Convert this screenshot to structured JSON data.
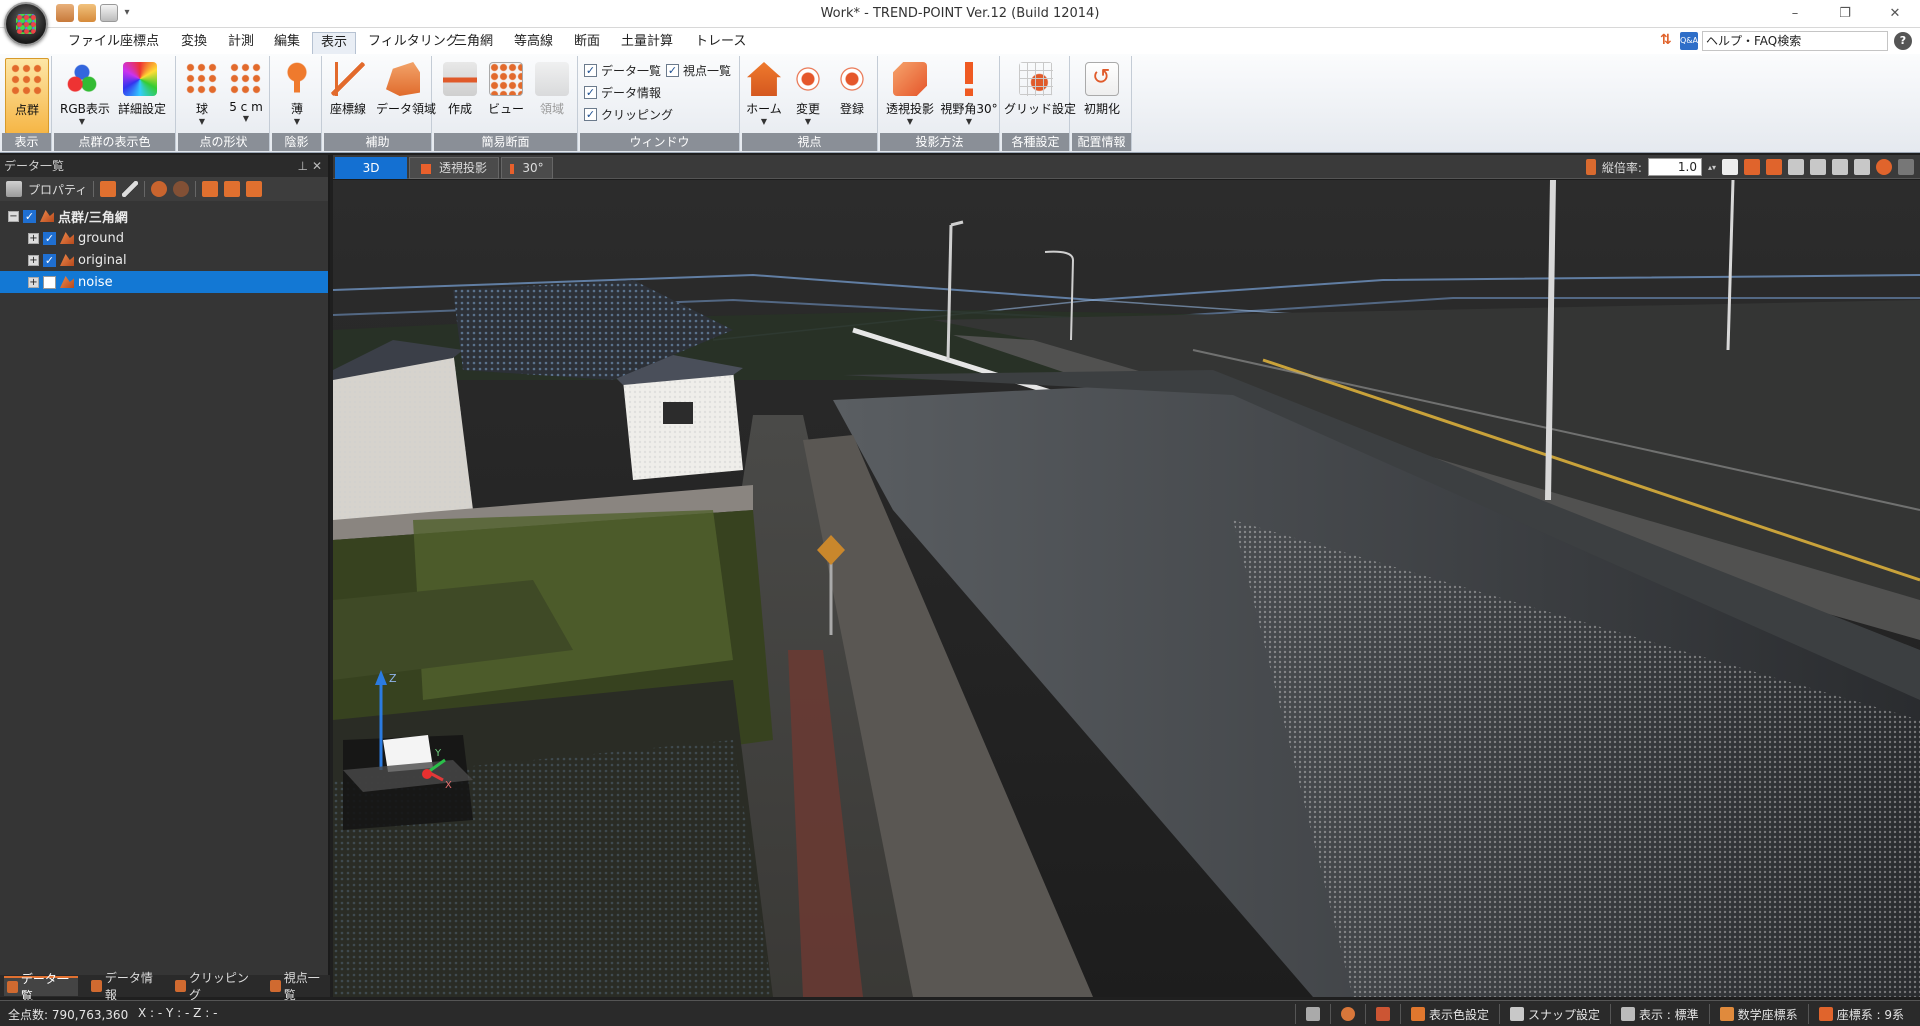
{
  "window": {
    "title": "Work* - TREND-POINT Ver.12 (Build 12014)",
    "minimize": "–",
    "maximize": "❐",
    "close": "✕"
  },
  "menu": {
    "tabs": [
      "ファイル",
      "座標点",
      "変換",
      "計測",
      "編集",
      "表示",
      "フィルタリング",
      "三角網",
      "等高線",
      "断面",
      "土量計算",
      "トレース"
    ],
    "active": "表示",
    "search_placeholder": "ヘルプ・FAQ検索",
    "qa_badge": "Q&A",
    "help": "?"
  },
  "ribbon": {
    "groups": {
      "display": "表示",
      "color": "点群の表示色",
      "shape": "点の形状",
      "shade": "陰影",
      "aux": "補助",
      "section": "簡易断面",
      "window": "ウィンドウ",
      "viewpoint": "視点",
      "projection": "投影方法",
      "settings": "各種設定",
      "layout": "配置情報"
    },
    "buttons": {
      "pointcloud": "点群",
      "rgb": "RGB表示",
      "detail": "詳細設定",
      "sphere": "球",
      "size": "5 c m",
      "thin": "薄",
      "axis": "座標線",
      "data_area": "データ領域",
      "make": "作成",
      "view": "ビュー",
      "area": "領域",
      "home": "ホーム",
      "change": "変更",
      "register": "登録",
      "perspective": "透視投影",
      "fov": "視野角30°",
      "grid": "グリッド設定",
      "init": "初期化"
    },
    "checks": {
      "data_list": "データ一覧",
      "viewpoint_list": "視点一覧",
      "data_info": "データ情報",
      "clipping": "クリッピング"
    }
  },
  "panel": {
    "title": "データ一覧",
    "toolbar_property": "プロパティ",
    "tree": {
      "root": "点群/三角網",
      "children": [
        {
          "label": "ground",
          "checked": true
        },
        {
          "label": "original",
          "checked": true
        },
        {
          "label": "noise",
          "checked": false
        }
      ]
    },
    "bottom_tabs": [
      "データ一覧",
      "データ情報",
      "クリッピング",
      "視点一覧"
    ]
  },
  "viewport": {
    "tabs": [
      "3D",
      "透視投影",
      "30°"
    ],
    "scale_label": "縦倍率:",
    "scale_value": "1.0",
    "axis_z": "Z",
    "axis_x": "X",
    "axis_y": "Y"
  },
  "status": {
    "total_points": "全点数: 790,763,360",
    "coords": "X : -  Y : -  Z : -",
    "color_setting": "表示色設定",
    "snap_setting": "スナップ設定",
    "display_mode": "表示 : 標準",
    "math_coords": "数学座標系",
    "coord_system": "座標系 : 9系"
  }
}
